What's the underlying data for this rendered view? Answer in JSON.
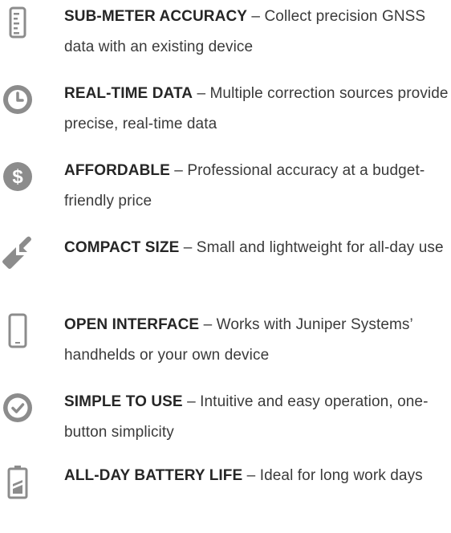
{
  "colors": {
    "icon": "#8c8c8c",
    "title": "#262626",
    "text": "#3a3a3a"
  },
  "features": [
    {
      "icon": "ruler-icon",
      "title": "SUB-METER ACCURACY",
      "separator": " – ",
      "description": "Collect precision GNSS data with an existing device"
    },
    {
      "icon": "clock-icon",
      "title": "REAL-TIME DATA",
      "separator": " – ",
      "description": "Multiple correction sources provide precise, real-time data"
    },
    {
      "icon": "dollar-icon",
      "title": "AFFORDABLE",
      "separator": " – ",
      "description": "Professional accuracy at a budget-friendly price"
    },
    {
      "icon": "compress-arrows-icon",
      "title": "COMPACT SIZE",
      "separator": " – ",
      "description": "Small and lightweight for all-day use"
    },
    {
      "icon": "smartphone-icon",
      "title": "OPEN INTERFACE",
      "separator": " – ",
      "description": "Works with Juniper Systems’ handhelds or your own device"
    },
    {
      "icon": "check-circle-icon",
      "title": "SIMPLE TO USE",
      "separator": " – ",
      "description": "Intuitive and easy operation, one-button simplicity"
    },
    {
      "icon": "battery-icon",
      "title": "ALL-DAY BATTERY LIFE",
      "separator": " – ",
      "description": "Ideal for long work days"
    }
  ]
}
